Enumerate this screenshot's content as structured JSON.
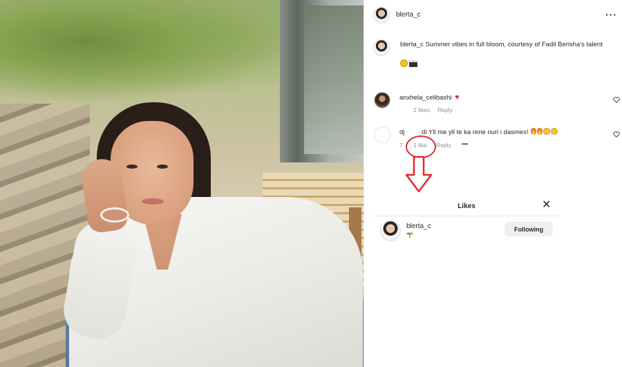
{
  "post": {
    "author": "blerta_c",
    "more_icon": "more-horizontal-icon",
    "caption_user": "blerta_c",
    "caption_text": "Summer vibes in full bloom, courtesy of Fadil Berisha's talent",
    "caption_emojis": [
      "sun-icon",
      "clapper-board-icon"
    ]
  },
  "comments": [
    {
      "user": "anxhela_celibashi",
      "text": "",
      "emoji": "red-heart-icon",
      "likes": "2 likes",
      "reply": "Reply"
    },
    {
      "user": "dj",
      "user_suffix": "di",
      "text": "Yll me yll te ka rene nuri i dasmes!",
      "emojis": [
        "fire-icon",
        "fire-icon",
        "crying-face-icon",
        "crying-face-icon"
      ],
      "time": "7",
      "likes": "1 like",
      "reply": "Reply",
      "more": "•••"
    }
  ],
  "likes_dialog": {
    "title": "Likes",
    "close_icon": "close-icon",
    "user": "blerta_c",
    "user_emoji": "plant-icon",
    "button": "Following"
  },
  "colors": {
    "annotation": "#e0292e",
    "meta_text": "#8e8e8e",
    "heart": "#e0245e"
  }
}
